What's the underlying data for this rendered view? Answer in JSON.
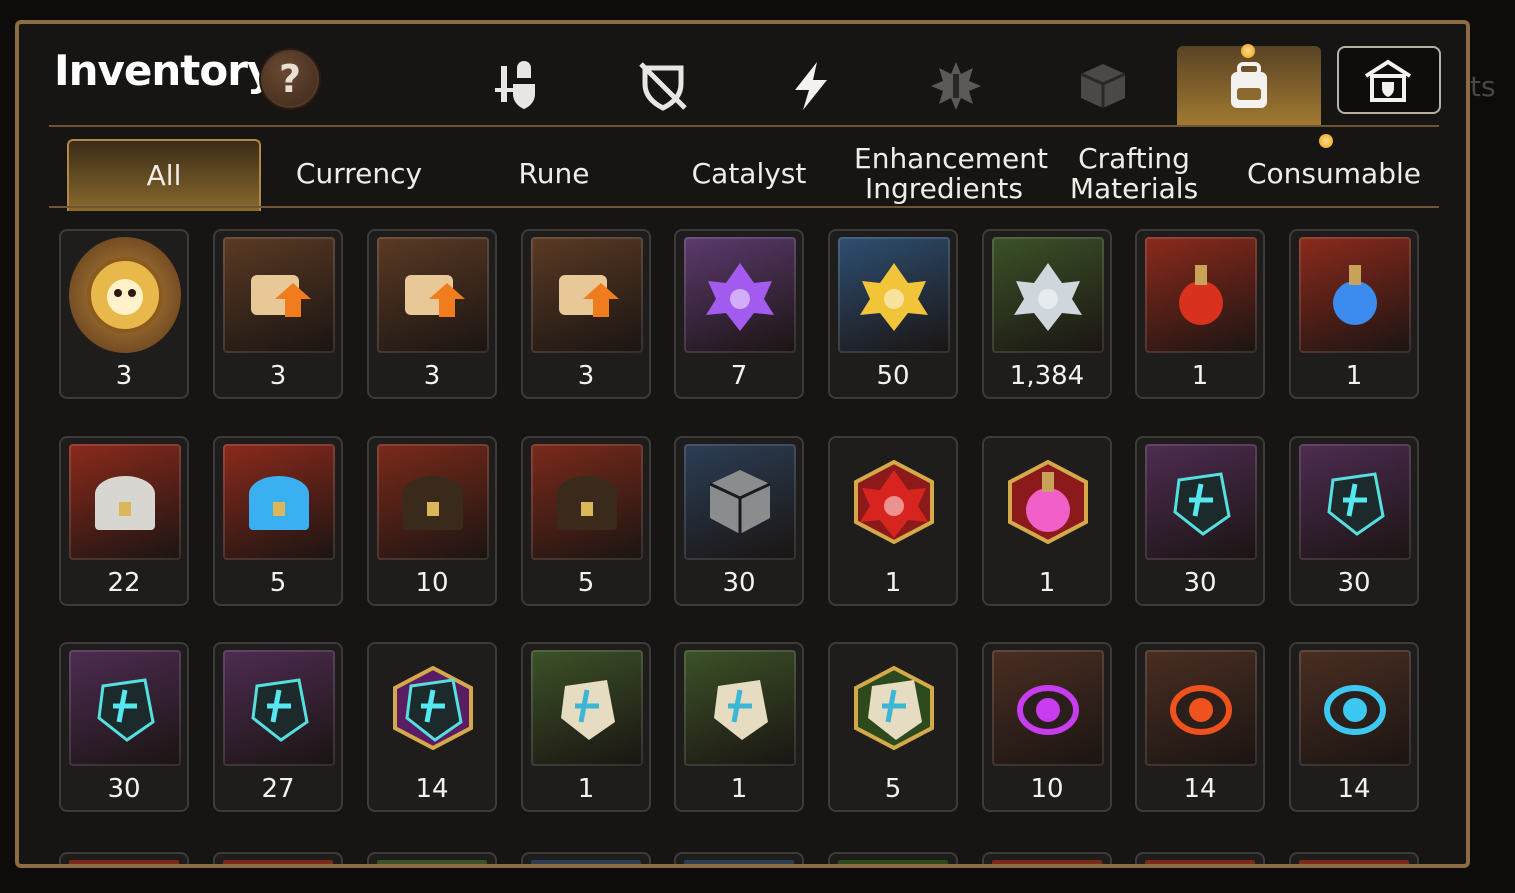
{
  "panel": {
    "title": "Inventory",
    "help_label": "?"
  },
  "background_text": {
    "right": "ts"
  },
  "category_icons": [
    {
      "name": "equipment-icon",
      "active": false
    },
    {
      "name": "disabled-shield-icon",
      "active": false
    },
    {
      "name": "lightning-icon",
      "active": false
    },
    {
      "name": "rune-burst-icon",
      "active": false
    },
    {
      "name": "cube-icon",
      "active": false
    },
    {
      "name": "backpack-icon",
      "active": true
    },
    {
      "name": "storage-icon",
      "active": false
    }
  ],
  "tabs": [
    {
      "label": "All",
      "active": true
    },
    {
      "label": "Currency",
      "active": false
    },
    {
      "label": "Rune",
      "active": false
    },
    {
      "label": "Catalyst",
      "active": false
    },
    {
      "label": "Enhancement Ingredients",
      "active": false
    },
    {
      "label": "Crafting Materials",
      "active": false
    },
    {
      "label": "Consumable",
      "active": false
    }
  ],
  "items": [
    {
      "icon": "mascot-coin-icon",
      "count": "3",
      "bg": "#b98a3d",
      "frame": "circle"
    },
    {
      "icon": "scroll-upgrade-icon",
      "count": "3",
      "bg": "#5a3a24",
      "frame": "square"
    },
    {
      "icon": "rainbow-scroll-icon",
      "count": "3",
      "bg": "#5a3a24",
      "frame": "square"
    },
    {
      "icon": "scroll-upgrade-icon",
      "count": "3",
      "bg": "#5a3a24",
      "frame": "square"
    },
    {
      "icon": "purple-crystal-icon",
      "count": "7",
      "bg": "#5c3a6e",
      "frame": "square"
    },
    {
      "icon": "gold-crystal-icon",
      "count": "50",
      "bg": "#2e4f72",
      "frame": "square"
    },
    {
      "icon": "silver-crystal-icon",
      "count": "1,384",
      "bg": "#3c5228",
      "frame": "square"
    },
    {
      "icon": "red-potion-icon",
      "count": "1",
      "bg": "#8c2a1c",
      "frame": "square"
    },
    {
      "icon": "blue-star-potion-icon",
      "count": "1",
      "bg": "#8c2a1c",
      "frame": "square"
    },
    {
      "icon": "silver-chest-icon",
      "count": "22",
      "bg": "#8c2a1c",
      "frame": "square"
    },
    {
      "icon": "blue-chest-icon",
      "count": "5",
      "bg": "#8c2a1c",
      "frame": "square"
    },
    {
      "icon": "dark-gold-chest-icon",
      "count": "10",
      "bg": "#7a2a1a",
      "frame": "square"
    },
    {
      "icon": "dark-gold-chest-icon",
      "count": "5",
      "bg": "#7a2a1a",
      "frame": "square"
    },
    {
      "icon": "grey-cube-icon",
      "count": "30",
      "bg": "#2c3e56",
      "frame": "square"
    },
    {
      "icon": "red-rune-shard-icon",
      "count": "1",
      "bg": "#8c1a1a",
      "frame": "hex"
    },
    {
      "icon": "pink-potion-icon",
      "count": "1",
      "bg": "#8c1a1a",
      "frame": "hex"
    },
    {
      "icon": "teal-sword-rune-icon",
      "count": "30",
      "bg": "#4e2c52",
      "frame": "square"
    },
    {
      "icon": "teal-swirl-rune-icon",
      "count": "30",
      "bg": "#4e2c52",
      "frame": "square"
    },
    {
      "icon": "teal-armor-rune-icon",
      "count": "30",
      "bg": "#4e2c52",
      "frame": "square"
    },
    {
      "icon": "teal-boot-rune-icon",
      "count": "27",
      "bg": "#4e2c52",
      "frame": "square"
    },
    {
      "icon": "teal-star-rune-icon",
      "count": "14",
      "bg": "#5a1c62",
      "frame": "hex"
    },
    {
      "icon": "stone-sword-rune-icon",
      "count": "1",
      "bg": "#3c5228",
      "frame": "square"
    },
    {
      "icon": "stone-swirl-rune-icon",
      "count": "1",
      "bg": "#3c5228",
      "frame": "square"
    },
    {
      "icon": "stone-star-rune-icon",
      "count": "5",
      "bg": "#2c4a1c",
      "frame": "hex"
    },
    {
      "icon": "purple-orb-icon",
      "count": "10",
      "bg": "#4a2e22",
      "frame": "square"
    },
    {
      "icon": "red-orb-icon",
      "count": "14",
      "bg": "#4a2e22",
      "frame": "square"
    },
    {
      "icon": "blue-orb-icon",
      "count": "14",
      "bg": "#4a2e22",
      "frame": "square"
    }
  ],
  "colors": {
    "panel_border": "#8c6c42",
    "accent_gold": "#b08a44",
    "active_tab": "#8a6a2e",
    "text": "#f0ece6"
  }
}
